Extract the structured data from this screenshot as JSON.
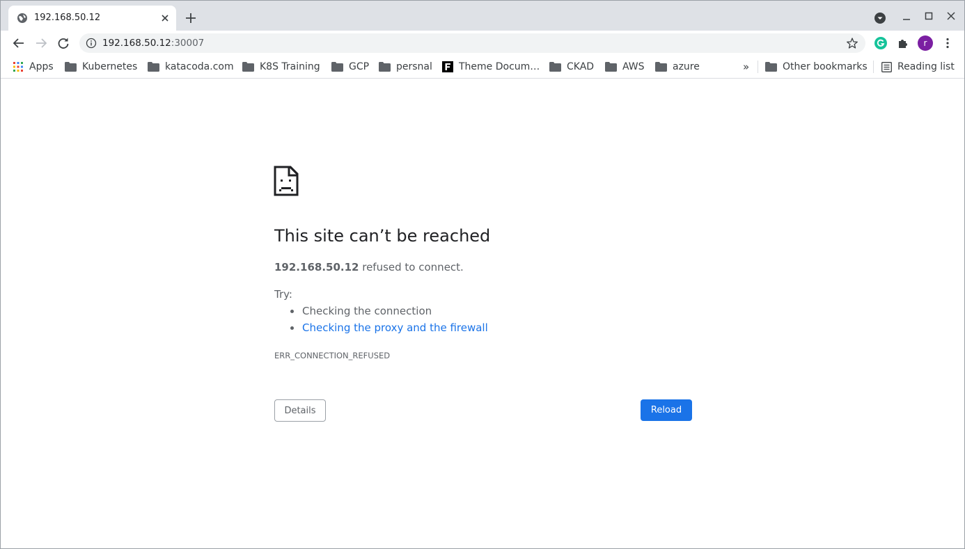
{
  "tab": {
    "title": "192.168.50.12"
  },
  "omnibox": {
    "host": "192.168.50.12",
    "port": ":30007"
  },
  "avatar_letter": "r",
  "bookmarks": {
    "apps": "Apps",
    "items": [
      "Kubernetes",
      "katacoda.com",
      "K8S Training",
      "GCP",
      "persnal",
      "Theme Docum…",
      "CKAD",
      "AWS",
      "azure"
    ],
    "overflow": "»",
    "other": "Other bookmarks",
    "reading_list": "Reading list"
  },
  "error": {
    "heading": "This site can’t be reached",
    "host": "192.168.50.12",
    "message": " refused to connect.",
    "try_label": "Try:",
    "suggestions": [
      "Checking the connection",
      "Checking the proxy and the firewall"
    ],
    "code": "ERR_CONNECTION_REFUSED",
    "details_button": "Details",
    "reload_button": "Reload"
  },
  "colors": {
    "accent": "#1a73e8",
    "tabstrip": "#dee1e6",
    "avatar": "#7b1fa2",
    "grammarly": "#15c39a"
  }
}
